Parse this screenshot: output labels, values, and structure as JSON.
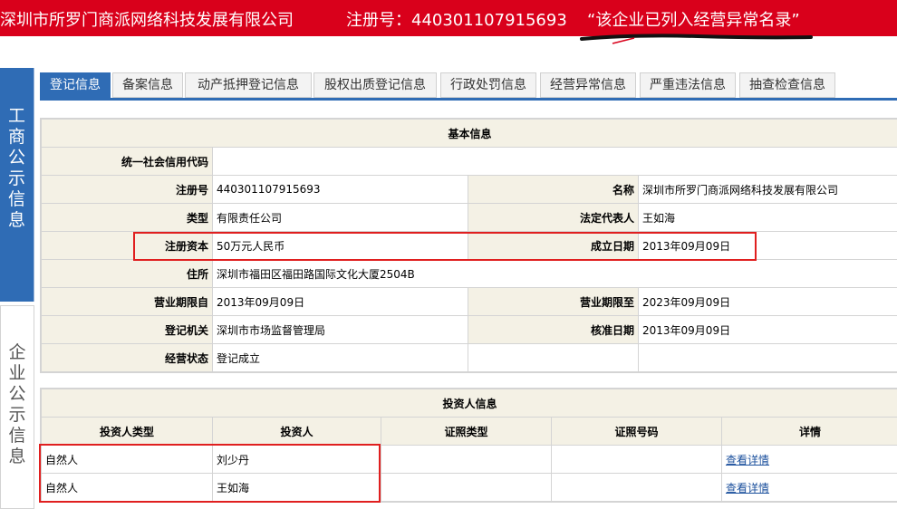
{
  "banner": {
    "company": "深圳市所罗门商派网络科技发展有限公司",
    "reg_no_text": "注册号：440301107915693",
    "notice": "“该企业已列入经营异常名录”",
    "bg_color": "#d9001b"
  },
  "side_nav": {
    "top_label": [
      "工",
      "商",
      "公",
      "示",
      "信",
      "息"
    ],
    "bottom_label": [
      "企",
      "业",
      "公",
      "示",
      "信",
      "息"
    ]
  },
  "tabs": [
    {
      "label": "登记信息",
      "active": true
    },
    {
      "label": "备案信息",
      "active": false
    },
    {
      "label": "动产抵押登记信息",
      "active": false
    },
    {
      "label": "股权出质登记信息",
      "active": false
    },
    {
      "label": "行政处罚信息",
      "active": false
    },
    {
      "label": "经营异常信息",
      "active": false
    },
    {
      "label": "严重违法信息",
      "active": false
    },
    {
      "label": "抽查检查信息",
      "active": false
    }
  ],
  "basic_info": {
    "title": "基本信息",
    "credit_code_label": "统一社会信用代码",
    "credit_code_value": "",
    "reg_no_label": "注册号",
    "reg_no_value": "440301107915693",
    "name_label": "名称",
    "name_value": "深圳市所罗门商派网络科技发展有限公司",
    "type_label": "类型",
    "type_value": "有限责任公司",
    "legal_rep_label": "法定代表人",
    "legal_rep_value": "王如海",
    "capital_label": "注册资本",
    "capital_value": "50万元人民币",
    "est_date_label": "成立日期",
    "est_date_value": "2013年09月09日",
    "address_label": "住所",
    "address_value": "深圳市福田区福田路国际文化大厦2504B",
    "term_from_label": "营业期限自",
    "term_from_value": "2013年09月09日",
    "term_to_label": "营业期限至",
    "term_to_value": "2023年09月09日",
    "authority_label": "登记机关",
    "authority_value": "深圳市市场监督管理局",
    "approval_date_label": "核准日期",
    "approval_date_value": "2013年09月09日",
    "status_label": "经营状态",
    "status_value": "登记成立"
  },
  "investors": {
    "title": "投资人信息",
    "headers": [
      "投资人类型",
      "投资人",
      "证照类型",
      "证照号码",
      "详情"
    ],
    "rows": [
      {
        "type": "自然人",
        "name": "刘少丹",
        "cert_type": "",
        "cert_no": "",
        "detail": "查看详情"
      },
      {
        "type": "自然人",
        "name": "王如海",
        "cert_type": "",
        "cert_no": "",
        "detail": "查看详情"
      }
    ]
  },
  "colors": {
    "accent_blue": "#2f6cb5",
    "label_bg": "#f4f1e5",
    "highlight_red": "#e01f1f"
  }
}
